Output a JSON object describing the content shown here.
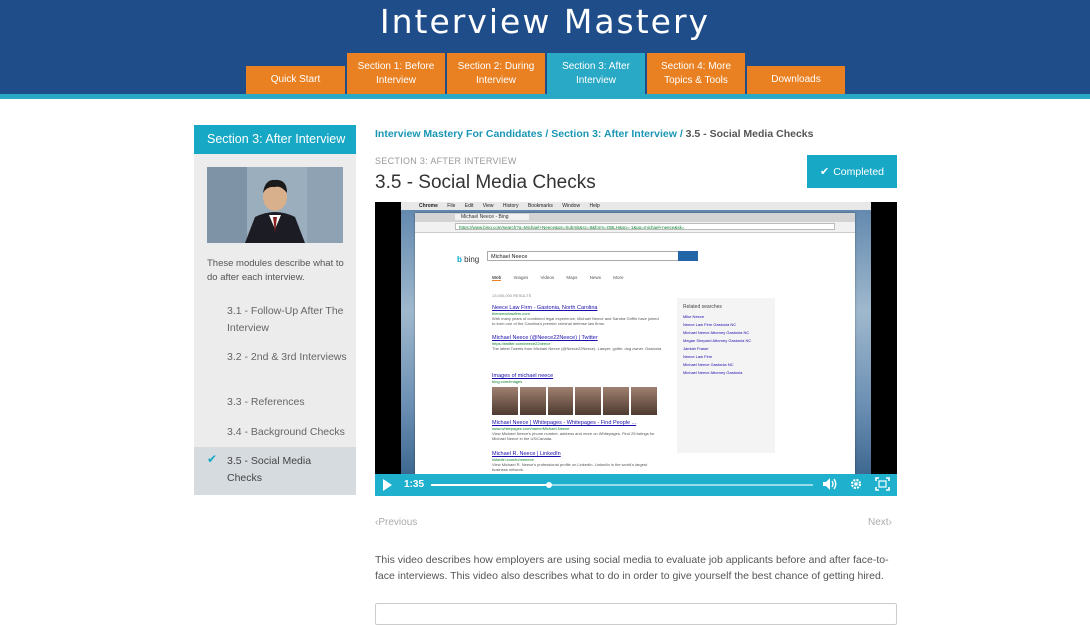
{
  "site": {
    "title": "Interview Mastery"
  },
  "nav": {
    "tabs": [
      {
        "label": "Quick Start"
      },
      {
        "label": "Section 1: Before Interview"
      },
      {
        "label": "Section 2: During Interview"
      },
      {
        "label": "Section 3: After Interview",
        "active": true
      },
      {
        "label": "Section 4: More Topics & Tools"
      },
      {
        "label": "Downloads"
      }
    ]
  },
  "sidebar": {
    "header": "Section 3: After Interview",
    "description": "These modules describe what to do after each interview.",
    "items": [
      {
        "label": "3.1 - Follow-Up After The Interview"
      },
      {
        "label": "3.2 - 2nd & 3rd Interviews"
      },
      {
        "label": "3.3 - References"
      },
      {
        "label": "3.4 - Background Checks"
      },
      {
        "label": "3.5 - Social Media Checks",
        "active": true,
        "completed": true
      }
    ]
  },
  "breadcrumb": {
    "items": [
      "Interview Mastery For Candidates",
      "Section 3: After Interview"
    ],
    "separator": "/",
    "current": "3.5 - Social Media Checks"
  },
  "lesson": {
    "kicker": "SECTION 3: AFTER INTERVIEW",
    "title": "3.5 - Social Media Checks",
    "completed_label": "Completed",
    "description": "This video describes how employers are using social media to evaluate job applicants before and after face-to-face interviews. This video also describes what to do in order to give yourself the best chance of getting hired."
  },
  "video": {
    "current_time": "1:35",
    "progress": 0.31,
    "screen": {
      "menubar": [
        "Chrome",
        "File",
        "Edit",
        "View",
        "History",
        "Bookmarks",
        "Window",
        "Help"
      ],
      "tab_title": "Michael Neece - Bing",
      "url": "https://www.bing.com/search?q=Michael+Neece&qs=Submit&sc=8&form=QBLH&sp=-1&pq=michael+neece&sk=",
      "search_query": "Michael Neece",
      "search_nav": [
        "Web",
        "Images",
        "Videos",
        "Maps",
        "News",
        "More"
      ],
      "results_count": "13,000,000 RESULTS",
      "results": [
        {
          "title": "Neece Law Firm - Gastonia, North Carolina",
          "url": "theneecelawfirm.com",
          "snippet": "With many years of combined legal experience, Michael Neece and Sandra Griffin have joined to form one of the Carolina's premier criminal defense law firms."
        },
        {
          "title": "Michael Neece (@Neece22Neece) | Twitter",
          "url": "https://twitter.com/neece22neece",
          "snippet": "The latest Tweets from Michael Neece (@Neece22Neece). Lawyer, golfer, dog owner. Gastonia"
        },
        {
          "title": "Images of michael neece",
          "url": "bing.com/images",
          "snippet": ""
        },
        {
          "title": "Michael Neece | Whitepages - Whitepages - Find People ...",
          "url": "www.whitepages.com/name/Michael-Neece",
          "snippet": "View Michael Neece's phone number, address and more on Whitepages. Find 25 listings for Michael Neece in the US/Canada."
        },
        {
          "title": "Michael R. Neece | LinkedIn",
          "url": "linkedin.com/in/mneece",
          "snippet": "View Michael R. Neece's professional profile on LinkedIn. LinkedIn is the world's largest business network."
        }
      ],
      "related_title": "Related searches",
      "related": [
        "Mike Neece",
        "Neece Law Firm Gastonia NC",
        "Michael Neece Attorney Gastonia NC",
        "Megan Shepard Attorney Gastonia NC",
        "Jamiah Fraser",
        "Neece Law Firm",
        "Michael Neece Gastonia NC",
        "Michael Neece Attorney Gastonia"
      ]
    }
  },
  "pager": {
    "previous": "Previous",
    "next": "Next"
  },
  "icons": {
    "check": "✔",
    "volume": "🔈",
    "settings": "⚙",
    "fullscreen": "⛶"
  },
  "colors": {
    "header": "#1f4d8a",
    "orange": "#e98022",
    "teal": "#17a8c6"
  }
}
